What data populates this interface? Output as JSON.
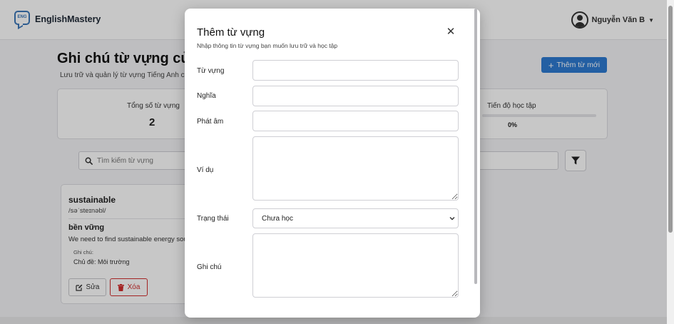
{
  "header": {
    "logo_text": "ENG",
    "brand": "EnglishMastery",
    "user_name": "Nguyễn Văn B"
  },
  "main": {
    "title": "Ghi chú từ vựng của",
    "subtitle": "Lưu trữ và quản lý từ vựng Tiếng Anh c",
    "add_button": "Thêm từ mới",
    "stats": {
      "total_label": "Tổng số từ vựng",
      "total_value": "2",
      "progress_label": "Tiến độ học tập",
      "progress_value": "0%",
      "progress_fraction": 0
    },
    "search": {
      "placeholder": "Tìm kiếm từ vựng"
    },
    "card": {
      "word": "sustainable",
      "phonetic": "/səˈsteɪnəbl/",
      "meaning": "bền vững",
      "example": "We need to find sustainable energy sourc",
      "note_label": "Ghi chú:",
      "note": "Chủ đề: Môi trường",
      "edit_label": "Sửa",
      "delete_label": "Xóa"
    }
  },
  "modal": {
    "title": "Thêm từ vựng",
    "subtitle": "Nhập thông tin từ vựng bạn muốn lưu trữ và học tập",
    "fields": {
      "word_label": "Từ vựng",
      "meaning_label": "Nghĩa",
      "pronunciation_label": "Phát âm",
      "example_label": "Ví dụ",
      "status_label": "Trạng thái",
      "status_value": "Chưa học",
      "note_label": "Ghi chú"
    }
  },
  "colors": {
    "accent": "#2e7ad1",
    "danger": "#d12d2d"
  }
}
